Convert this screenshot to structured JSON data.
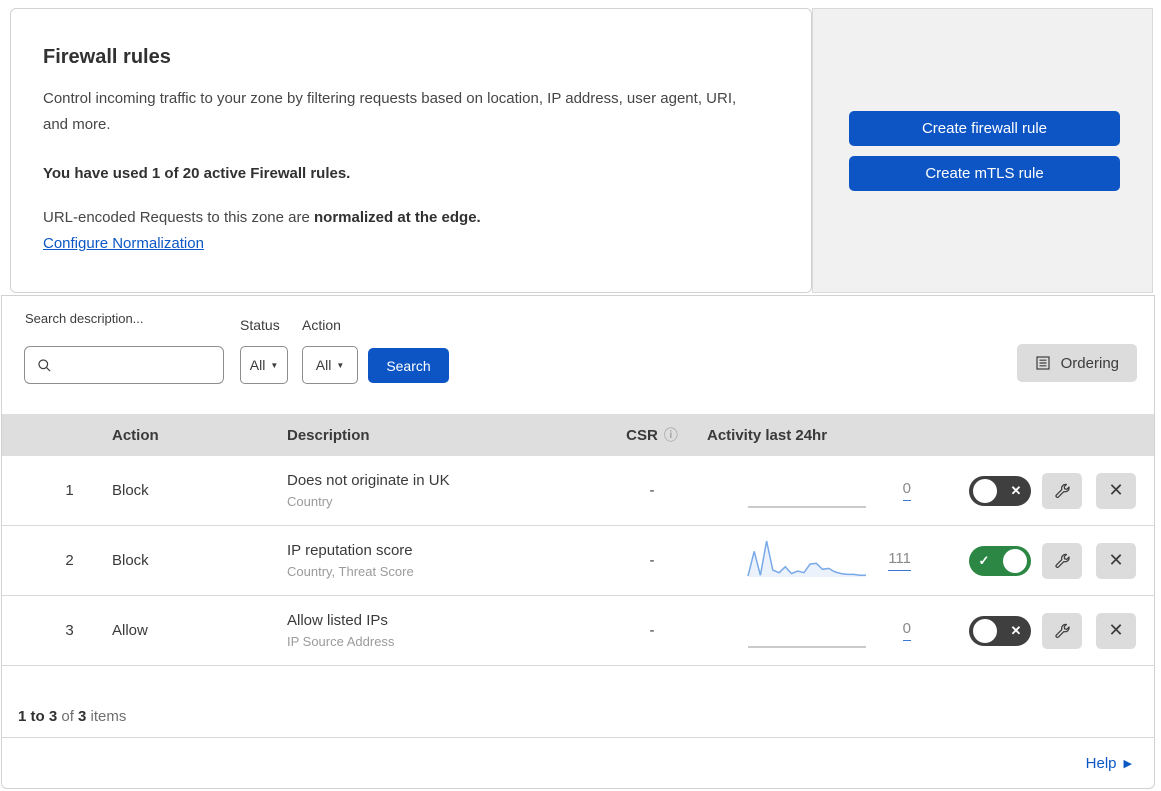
{
  "intro": {
    "title": "Firewall rules",
    "description": "Control incoming traffic to your zone by filtering requests based on location, IP address, user agent, URI, and more.",
    "usage": "You have used 1 of 20 active Firewall rules.",
    "normalization_prefix": "URL-encoded Requests to this zone are ",
    "normalization_bold": "normalized at the edge.",
    "normalization_link": "Configure Normalization"
  },
  "actions_panel": {
    "create_firewall_label": "Create firewall rule",
    "create_mtls_label": "Create mTLS rule"
  },
  "filters": {
    "search_label": "Search description...",
    "search_value": "",
    "status_label": "Status",
    "status_value": "All",
    "action_label": "Action",
    "action_value": "All",
    "search_button_label": "Search",
    "ordering_button_label": "Ordering"
  },
  "table": {
    "headers": {
      "action": "Action",
      "description": "Description",
      "csr": "CSR",
      "csr_info_icon": "info-icon",
      "activity": "Activity last 24hr"
    },
    "rows": [
      {
        "priority": "1",
        "action": "Block",
        "description": "Does not originate in UK",
        "criteria": "Country",
        "csr": "-",
        "activity_count": "0",
        "enabled": false,
        "sparkline": [
          0,
          0,
          0,
          0,
          0,
          0,
          0,
          0,
          0,
          0,
          0,
          0,
          0,
          0,
          0,
          0,
          0,
          0,
          0,
          0
        ]
      },
      {
        "priority": "2",
        "action": "Block",
        "description": "IP reputation score",
        "criteria": "Country, Threat Score",
        "csr": "-",
        "activity_count": "111",
        "enabled": true,
        "sparkline": [
          1,
          30,
          2,
          42,
          8,
          5,
          12,
          4,
          7,
          5,
          15,
          16,
          9,
          10,
          6,
          4,
          3,
          3,
          2,
          2
        ]
      },
      {
        "priority": "3",
        "action": "Allow",
        "description": "Allow listed IPs",
        "criteria": "IP Source Address",
        "csr": "-",
        "activity_count": "0",
        "enabled": false,
        "sparkline": [
          0,
          0,
          0,
          0,
          0,
          0,
          0,
          0,
          0,
          0,
          0,
          0,
          0,
          0,
          0,
          0,
          0,
          0,
          0,
          0
        ]
      }
    ]
  },
  "chart_data": {
    "type": "area",
    "title": "Activity last 24hr sparkline (rule 2)",
    "x": [
      1,
      2,
      3,
      4,
      5,
      6,
      7,
      8,
      9,
      10,
      11,
      12,
      13,
      14,
      15,
      16,
      17,
      18,
      19,
      20
    ],
    "values": [
      1,
      30,
      2,
      42,
      8,
      5,
      12,
      4,
      7,
      5,
      15,
      16,
      9,
      10,
      6,
      4,
      3,
      3,
      2,
      2
    ],
    "total_events": 111,
    "xlabel": "",
    "ylabel": "",
    "ylim": [
      0,
      42
    ],
    "grid": false,
    "axes_hidden": true,
    "line_color": "#78a9e8",
    "fill_color": "rgba(120,169,232,0.15)"
  },
  "footer": {
    "range": "1 to 3",
    "of_text": " of ",
    "total": "3",
    "items_text": " items",
    "help_label": "Help"
  },
  "colors": {
    "primary_blue": "#0d55c4",
    "link_blue": "#0b57c4",
    "toggle_on_green": "#2c8744",
    "toggle_off_gray": "#3f3f3f",
    "header_band_gray": "#dedede",
    "button_gray": "#dcdcdc",
    "panel_gray": "#f1f1f1",
    "sparkline_blue": "#78a9e8",
    "sparkline_flat_gray": "#b9b9b9"
  }
}
